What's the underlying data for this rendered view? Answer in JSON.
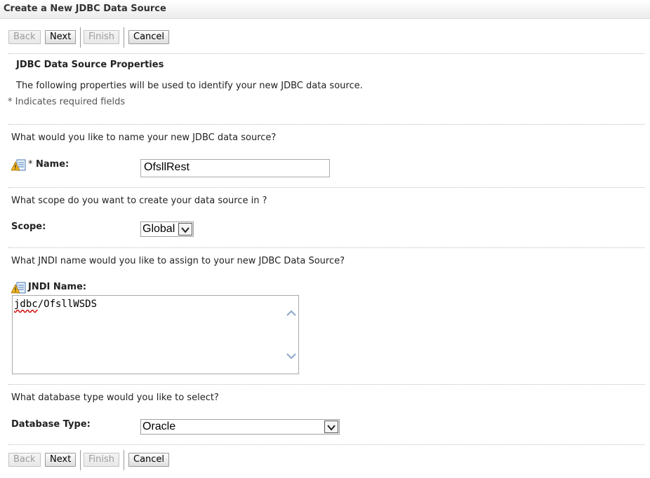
{
  "window": {
    "title": "Create a New JDBC Data Source"
  },
  "nav": {
    "back": "Back",
    "next": "Next",
    "finish": "Finish",
    "cancel": "Cancel"
  },
  "section": {
    "heading": "JDBC Data Source Properties",
    "description": "The following properties will be used to identify your new JDBC data source.",
    "required_note": "* Indicates required fields"
  },
  "name_step": {
    "question": "What would you like to name your new JDBC data source?",
    "label": "Name:",
    "required_marker": "*",
    "value": "OfsllRest"
  },
  "scope_step": {
    "question": "What scope do you want to create your data source in ?",
    "label": "Scope:",
    "value": "Global"
  },
  "jndi_step": {
    "question": "What JNDI name would you like to assign to your new JDBC Data Source?",
    "label": "JNDI Name:",
    "value": "jdbc/OfsllWSDS"
  },
  "dbtype_step": {
    "question": "What database type would you like to select?",
    "label": "Database Type:",
    "value": "Oracle"
  },
  "icons": {
    "field_help": "info-warning-icon",
    "dropdown": "chevron-down-icon",
    "scroll_up": "chevron-up-icon",
    "scroll_down": "chevron-down-icon"
  }
}
